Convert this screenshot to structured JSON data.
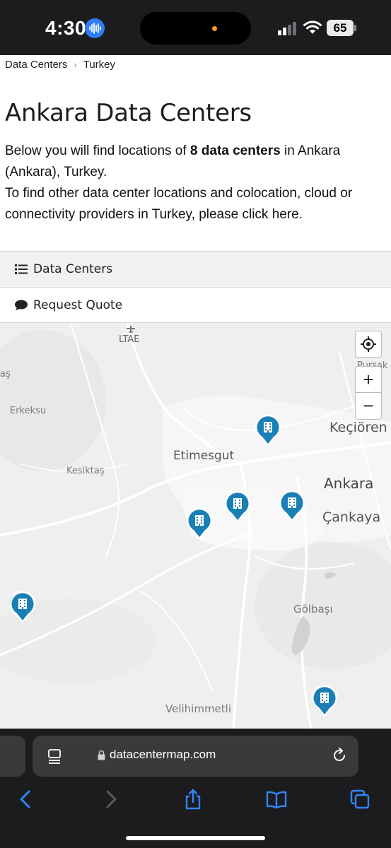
{
  "status_bar": {
    "time": "4:30",
    "battery": "65"
  },
  "breadcrumb": {
    "items": [
      "Data Centers",
      "Turkey"
    ]
  },
  "page": {
    "title": "Ankara Data Centers",
    "intro_1": "Below you will find locations of ",
    "intro_bold": "8 data centers",
    "intro_2": " in Ankara (Ankara), Turkey.",
    "intro_3": "To find other data center locations and colocation, cloud or connectivity providers in Turkey, ",
    "intro_link": "please click here",
    "intro_end": "."
  },
  "tabs": {
    "data_centers": "Data Centers",
    "request_quote": "Request Quote"
  },
  "map": {
    "labels": {
      "ltae": "LTAE",
      "pursak": "Pursak",
      "as": "aş",
      "erkeksu": "Erkeksu",
      "kecioren": "Keçiören",
      "etimesgut": "Etimesgut",
      "kesiktas": "Kesiktaş",
      "ankara": "Ankara",
      "cankaya": "Çankaya",
      "golbasi": "Gölbaşı",
      "velihimmetli": "Velihimmetli"
    },
    "zoom_in": "+",
    "zoom_out": "−",
    "accent": "#1a7fb5"
  },
  "browser": {
    "url": "datacentermap.com"
  }
}
